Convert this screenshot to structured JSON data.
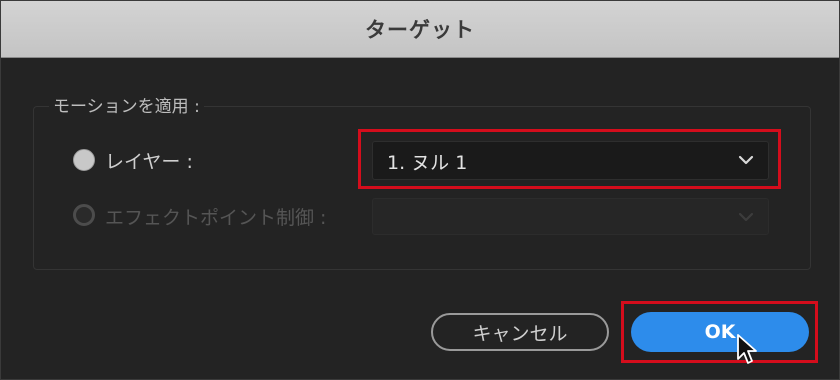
{
  "dialog": {
    "title": "ターゲット"
  },
  "motion_group": {
    "label": "モーションを適用 :",
    "layer_option": {
      "label": "レイヤー :",
      "selected": true,
      "enabled": true
    },
    "layer_select": {
      "value": "1. ヌル 1"
    },
    "effect_point_option": {
      "label": "エフェクトポイント制御 :",
      "selected": false,
      "enabled": false
    },
    "effect_point_select": {
      "value": ""
    }
  },
  "buttons": {
    "cancel_label": "キャンセル",
    "ok_label": "OK"
  },
  "icons": {
    "select_arrow": "chevron-down-icon",
    "cursor": "mouse-pointer-icon"
  },
  "colors": {
    "accent": "#2d8ceb",
    "highlight": "#d40d1c",
    "background": "#232323",
    "titlebar": "#c8c8c8"
  }
}
